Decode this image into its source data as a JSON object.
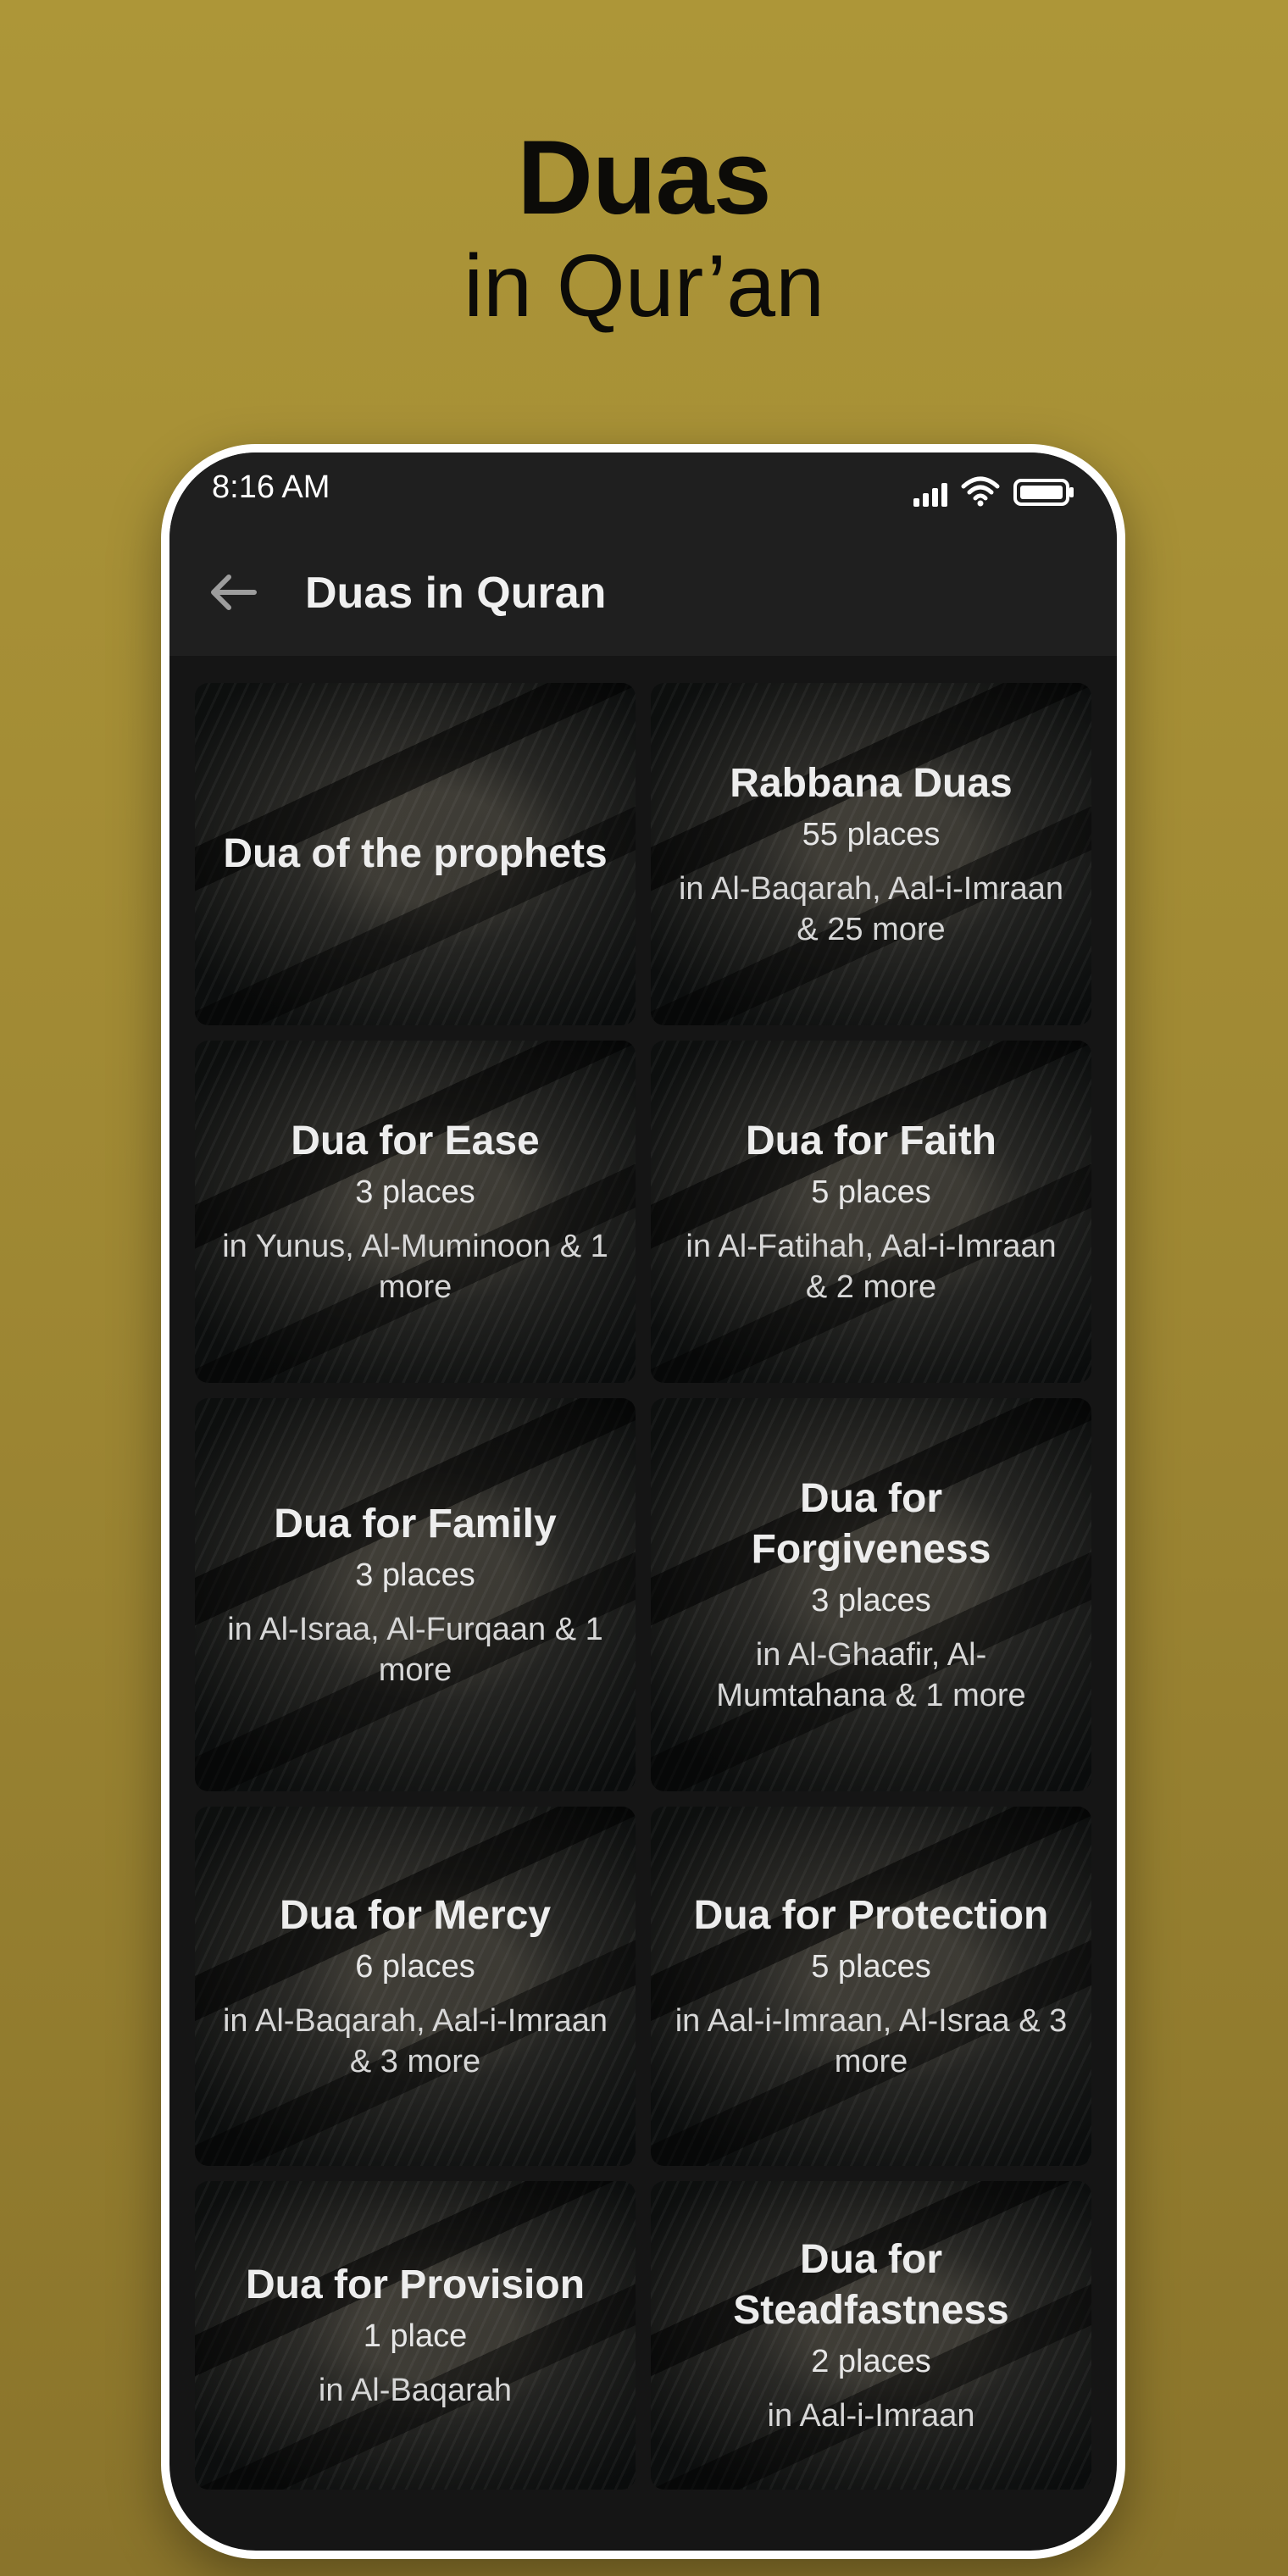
{
  "promo": {
    "title": "Duas",
    "subtitle": "in Qur’an"
  },
  "status_bar": {
    "time": "8:16 AM"
  },
  "app_bar": {
    "title": "Duas in Quran"
  },
  "icons": {
    "back": "arrow-left-icon",
    "signal": "cellular-signal-icon",
    "wifi": "wifi-icon",
    "battery": "battery-icon"
  },
  "categories": [
    {
      "title": "Dua of the prophets",
      "places": "",
      "surahs": ""
    },
    {
      "title": "Rabbana Duas",
      "places": "55 places",
      "surahs": "in Al-Baqarah, Aal-i-Imraan & 25 more"
    },
    {
      "title": "Dua for Ease",
      "places": "3 places",
      "surahs": "in Yunus, Al-Muminoon & 1 more"
    },
    {
      "title": "Dua for Faith",
      "places": "5 places",
      "surahs": "in Al-Fatihah, Aal-i-Imraan & 2 more"
    },
    {
      "title": "Dua for Family",
      "places": "3 places",
      "surahs": "in Al-Israa, Al-Furqaan & 1 more"
    },
    {
      "title": "Dua for Forgiveness",
      "places": "3 places",
      "surahs": "in Al-Ghaafir, Al-Mumtahana & 1 more"
    },
    {
      "title": "Dua for Mercy",
      "places": "6 places",
      "surahs": "in Al-Baqarah, Aal-i-Imraan & 3 more"
    },
    {
      "title": "Dua for Protection",
      "places": "5 places",
      "surahs": "in Aal-i-Imraan, Al-Israa & 3 more"
    },
    {
      "title": "Dua for Provision",
      "places": "1 place",
      "surahs": "in Al-Baqarah"
    },
    {
      "title": "Dua for Steadfastness",
      "places": "2 places",
      "surahs": "in Aal-i-Imraan"
    }
  ]
}
